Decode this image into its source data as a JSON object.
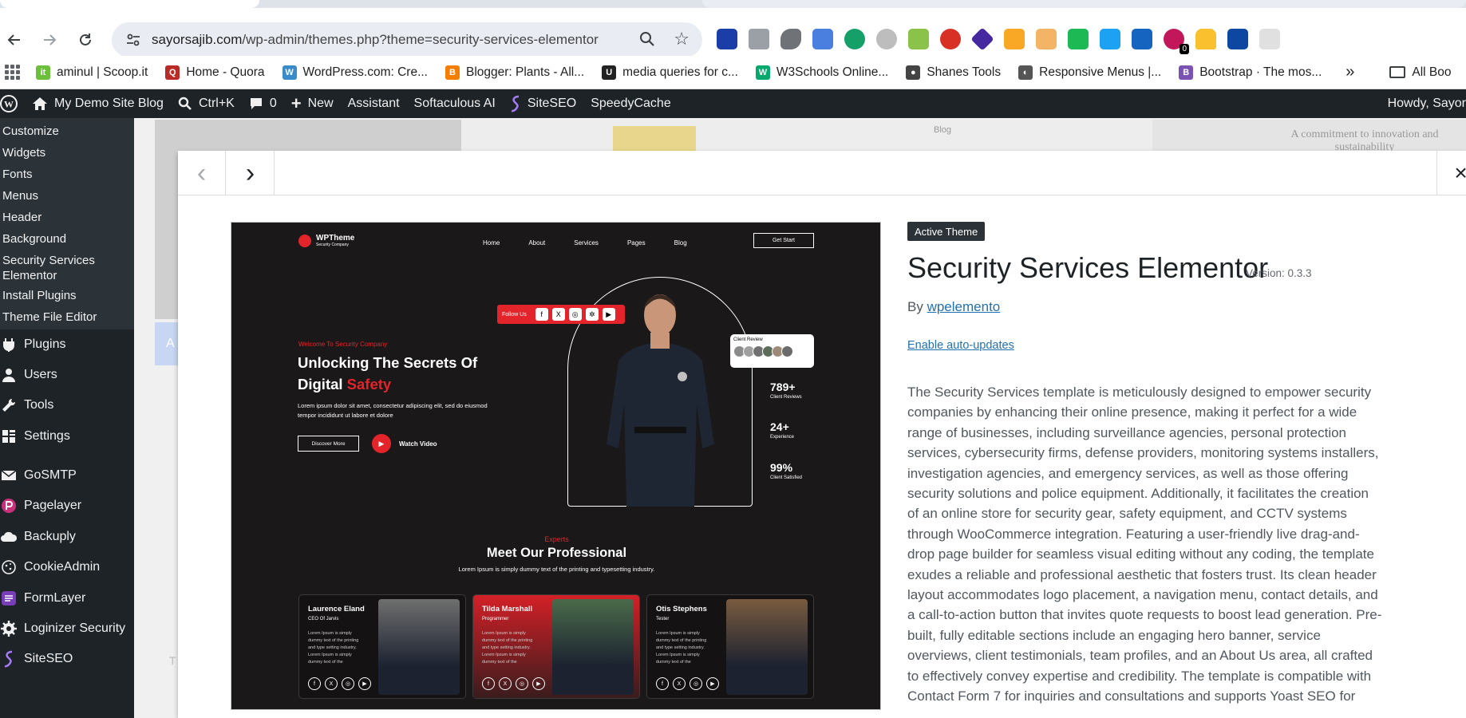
{
  "browser": {
    "url_domain": "sayorsajib.com",
    "url_path": "/wp-admin/themes.php?theme=security-services-elementor",
    "extension_badge": "0",
    "bookmarks": [
      {
        "label": "aminul | Scoop.it",
        "color": "#6bbf3a",
        "glyph": "it"
      },
      {
        "label": "Home - Quora",
        "color": "#b92b27",
        "glyph": "Q"
      },
      {
        "label": "WordPress.com: Cre...",
        "color": "#3a8bc9",
        "glyph": "W"
      },
      {
        "label": "Blogger: Plants - All...",
        "color": "#f57d00",
        "glyph": "B"
      },
      {
        "label": "media queries for c...",
        "color": "#222222",
        "glyph": "U"
      },
      {
        "label": "W3Schools Online...",
        "color": "#04aa6d",
        "glyph": "W"
      },
      {
        "label": "Shanes Tools",
        "color": "#444444",
        "glyph": "●"
      },
      {
        "label": "Responsive Menus |...",
        "color": "#555555",
        "glyph": "◐"
      },
      {
        "label": "Bootstrap · The mos...",
        "color": "#7952b3",
        "glyph": "B"
      }
    ],
    "bookmarks_overflow": "»",
    "all_bookmarks": "All Boo"
  },
  "adminbar": {
    "site_name": "My Demo Site Blog",
    "search_shortcut": "Ctrl+K",
    "comments_count": "0",
    "new_label": "New",
    "assistant": "Assistant",
    "softaculous": "Softaculous AI",
    "siteseo": "SiteSEO",
    "speedycache": "SpeedyCache",
    "howdy": "Howdy, Sayor"
  },
  "sidebar": {
    "submenu": [
      "Customize",
      "Widgets",
      "Fonts",
      "Menus",
      "Header",
      "Background",
      "Security Services Elementor",
      "Install Plugins",
      "Theme File Editor"
    ],
    "menu": [
      {
        "label": "Plugins",
        "icon": "plugin-icon"
      },
      {
        "label": "Users",
        "icon": "users-icon"
      },
      {
        "label": "Tools",
        "icon": "wrench-icon"
      },
      {
        "label": "Settings",
        "icon": "settings-icon"
      },
      {
        "label": "GoSMTP",
        "icon": "mail-icon"
      },
      {
        "label": "Pagelayer",
        "icon": "pagelayer-icon"
      },
      {
        "label": "Backuply",
        "icon": "cloud-icon"
      },
      {
        "label": "CookieAdmin",
        "icon": "cookie-icon"
      },
      {
        "label": "FormLayer",
        "icon": "formlayer-icon"
      },
      {
        "label": "Loginizer Security",
        "icon": "gear-icon"
      },
      {
        "label": "SiteSEO",
        "icon": "siteseo-icon"
      }
    ]
  },
  "background": {
    "faded_text": "A commitment to innovation and sustainability",
    "blog_label": "Blog",
    "chip_letter": "A",
    "t_letter": "T"
  },
  "modal": {
    "prev": "‹",
    "next": "›",
    "close": "×"
  },
  "screenshot": {
    "logo_title": "WPTheme",
    "logo_sub": "Security Company",
    "nav": [
      "Home",
      "About",
      "Services",
      "Pages",
      "Blog"
    ],
    "cta": "Get Start",
    "follow": "Follow Us",
    "social": [
      "f",
      "X",
      "◎",
      "✲",
      "▶"
    ],
    "review": "Client Review",
    "stats": [
      {
        "value": "789+",
        "label": "Client Reviews"
      },
      {
        "value": "24+",
        "label": "Experience"
      },
      {
        "value": "99%",
        "label": "Client Satisfied"
      }
    ],
    "welcome": "Welcome To Security Company",
    "hero_title": "Unlocking The Secrets Of Digital",
    "hero_highlight": "Safety",
    "hero_text": "Lorem ipsum dolor sit amet, consectetur adipiscing elit, sed do eiusmod tempor incididunt ut labore et dolore",
    "discover": "Discover More",
    "watch": "Watch Video",
    "experts": "Experts",
    "meet": "Meet Our Professional",
    "lorem": "Lorem Ipsum is simply dummy text of the printing and typesetting industry.",
    "cards": [
      {
        "name": "Laurence Eland",
        "role": "CEO Of Jarvis",
        "bio": "Lorem Ipsum is simply dummy text of the printing and type setting industry. Lorem Ipsum is simply dummy text of the"
      },
      {
        "name": "Tilda Marshall",
        "role": "Programmer",
        "bio": "Lorem Ipsum is simply dummy text of the printing and type setting industry. Lorem Ipsum is simply dummy text of the"
      },
      {
        "name": "Otis Stephens",
        "role": "Tester",
        "bio": "Lorem Ipsum is simply dummy text of the printing and type setting industry. Lorem Ipsum is simply dummy text of the"
      }
    ]
  },
  "theme": {
    "badge": "Active Theme",
    "name": "Security Services Elementor",
    "version": "Version: 0.3.3",
    "by": "By",
    "author": "wpelemento",
    "auto_updates": "Enable auto-updates",
    "description": "The Security Services template is meticulously designed to empower security companies by enhancing their online presence, making it perfect for a wide range of businesses, including surveillance agencies, personal protection services, cybersecurity firms, defense providers, monitoring systems installers, investigation agencies, and emergency services, as well as those offering security solutions and police equipment. Additionally, it facilitates the creation of an online store for security gear, safety equipment, and CCTV systems through WooCommerce integration. Featuring a user-friendly live drag-and-drop page builder for seamless visual editing without any coding, the template exudes a reliable and professional aesthetic that fosters trust. Its clean header layout accommodates logo placement, a navigation menu, contact details, and a call-to-action button that invites quote requests to boost lead generation. Pre-built, fully editable sections include an engaging hero banner, service overviews, client testimonials, team profiles, and an About Us area, all crafted to effectively convey expertise and credibility. The template is compatible with Contact Form 7 for inquiries and consultations and supports Yoast SEO for"
  },
  "colors": {
    "wp_dark": "#1d2327",
    "wp_link": "#2271b1",
    "accent_red": "#e3242b"
  }
}
